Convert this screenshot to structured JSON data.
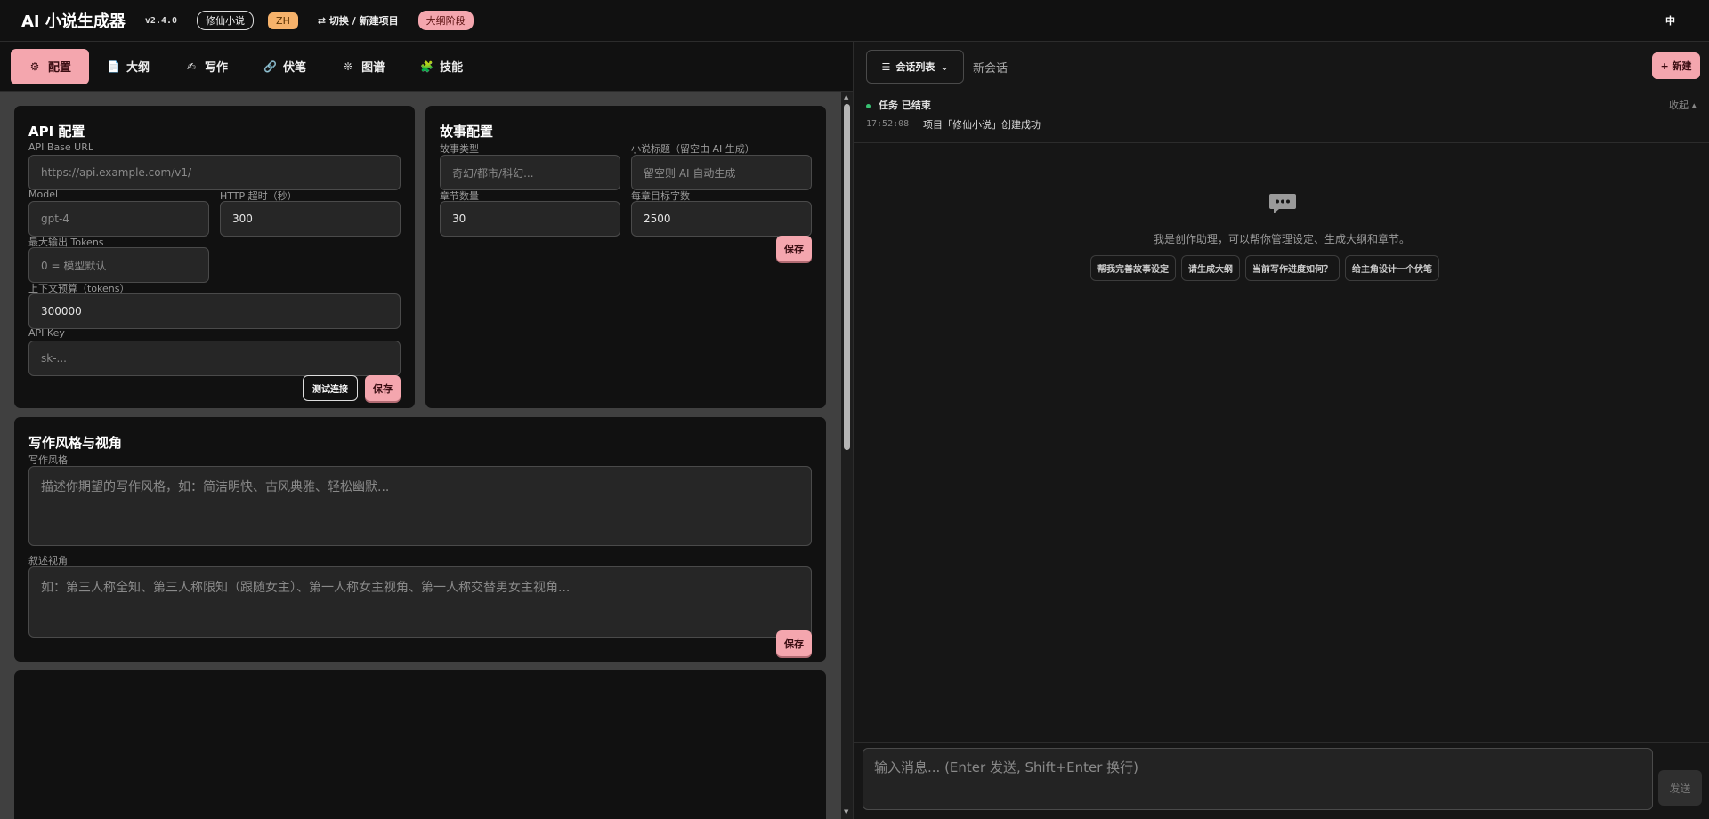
{
  "header": {
    "title": "AI 小说生成器",
    "version": "v2.4.0",
    "project": "修仙小说",
    "lang_badge": "ZH",
    "switch_label": "⇄ 切换 / 新建项目",
    "stage": "大纲阶段",
    "lang_right": "中"
  },
  "tabs": [
    {
      "label": "配置",
      "icon": "⚙"
    },
    {
      "label": "大纲",
      "icon": "📄"
    },
    {
      "label": "写作",
      "icon": "✍"
    },
    {
      "label": "伏笔",
      "icon": "🔗"
    },
    {
      "label": "图谱",
      "icon": "❊"
    },
    {
      "label": "技能",
      "icon": "🧩"
    }
  ],
  "api": {
    "title": "API 配置",
    "base_url_label": "API Base URL",
    "base_url_placeholder": "https://api.example.com/v1/",
    "model_label": "Model",
    "model_placeholder": "gpt-4",
    "timeout_label": "HTTP 超时（秒）",
    "timeout_value": "300",
    "max_tokens_label": "最大输出 Tokens",
    "max_tokens_placeholder": "0 = 模型默认",
    "context_label": "上下文预算（tokens）",
    "context_value": "300000",
    "key_label": "API Key",
    "key_placeholder": "sk-...",
    "test_label": "测试连接",
    "save_label": "保存"
  },
  "story": {
    "title": "故事配置",
    "genre_label": "故事类型",
    "genre_placeholder": "奇幻/都市/科幻...",
    "novel_title_label": "小说标题（留空由 AI 生成）",
    "novel_title_placeholder": "留空则 AI 自动生成",
    "chapters_label": "章节数量",
    "chapters_value": "30",
    "words_label": "每章目标字数",
    "words_value": "2500",
    "save_label": "保存"
  },
  "style": {
    "title": "写作风格与视角",
    "style_label": "写作风格",
    "style_placeholder": "描述你期望的写作风格，如：简洁明快、古风典雅、轻松幽默...",
    "pov_label": "叙述视角",
    "pov_placeholder": "如：第三人称全知、第三人称限知（跟随女主）、第一人称女主视角、第一人称交替男女主视角...",
    "save_label": "保存"
  },
  "chat": {
    "conv_list": "会话列表",
    "new_conv": "新会话",
    "new_btn": "+ 新建",
    "task": "任务 已结束",
    "collapse": "收起 ▴",
    "time": "17:52:08",
    "log": "项目「修仙小说」创建成功",
    "hint": "我是创作助理，可以帮你管理设定、生成大纲和章节。",
    "chips": [
      "帮我完善故事设定",
      "请生成大纲",
      "当前写作进度如何？",
      "给主角设计一个伏笔"
    ],
    "input_placeholder": "输入消息... (Enter 发送, Shift+Enter 换行)",
    "send": "发送"
  }
}
